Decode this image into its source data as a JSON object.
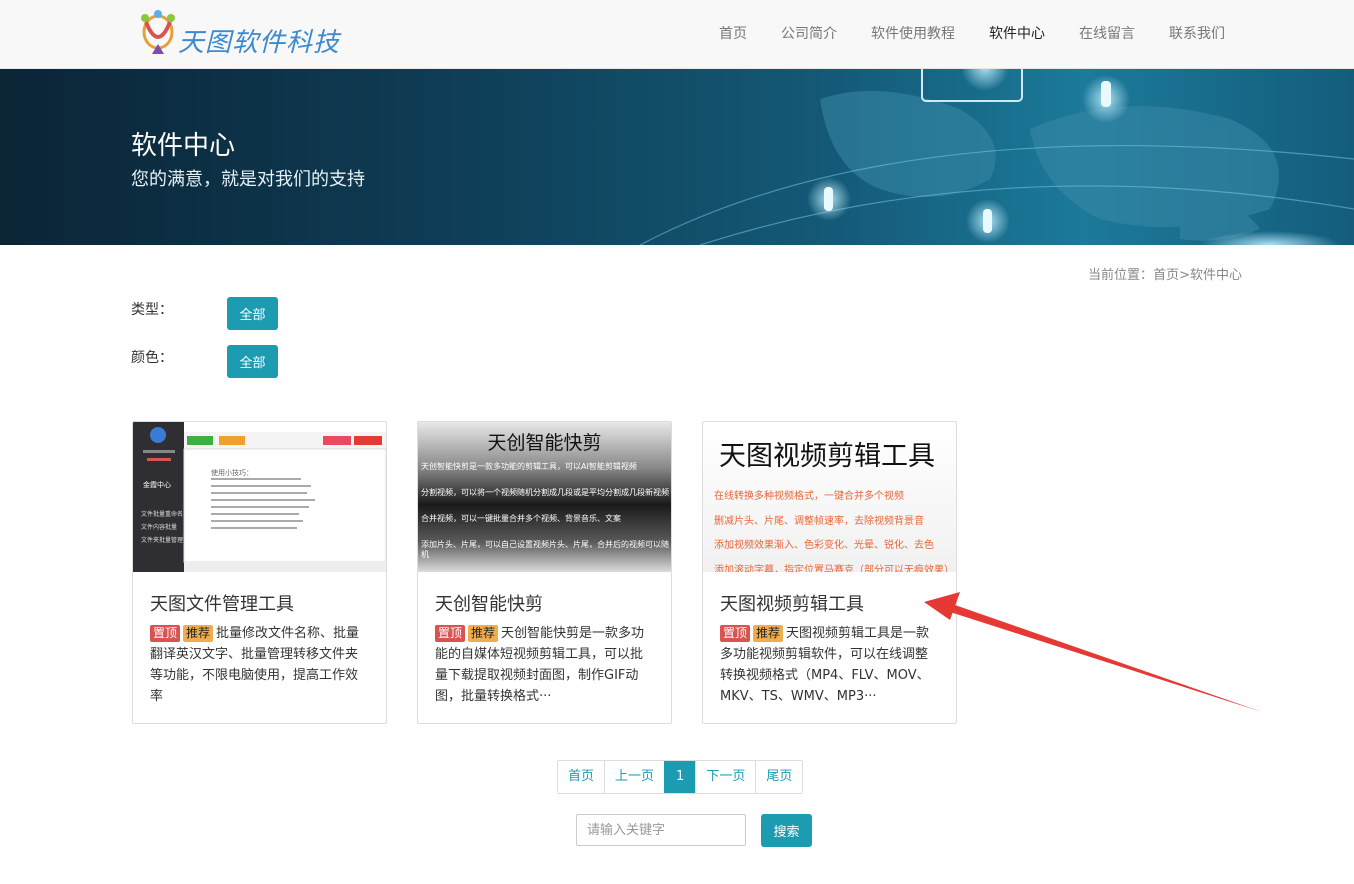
{
  "header": {
    "logo_text": "天图软件科技",
    "nav": [
      {
        "label": "首页"
      },
      {
        "label": "公司简介"
      },
      {
        "label": "软件使用教程"
      },
      {
        "label": "软件中心",
        "active": true
      },
      {
        "label": "在线留言"
      },
      {
        "label": "联系我们"
      }
    ]
  },
  "banner": {
    "title": "软件中心",
    "subtitle": "您的满意，就是对我们的支持"
  },
  "breadcrumb": {
    "prefix": "当前位置：",
    "home": "首页",
    "separator": ">",
    "current": "软件中心"
  },
  "filters": {
    "type_label": "类型：",
    "type_value": "全部",
    "color_label": "颜色：",
    "color_value": "全部"
  },
  "badges": {
    "top": "置顶",
    "recommend": "推荐"
  },
  "cards": [
    {
      "title": "天图文件管理工具",
      "desc": "批量修改文件名称、批量翻译英汉文字、批量管理转移文件夹等功能，不限电脑使用，提高工作效率",
      "thumb": {
        "app_brand": "金霞中心",
        "hint_title": "使用小技巧：",
        "menu": [
          "文件批量重命名",
          "文件内容批量",
          "文件夹批量管理"
        ]
      }
    },
    {
      "title": "天创智能快剪",
      "desc": "天创智能快剪是一款多功能的自媒体短视频剪辑工具，可以批量下载提取视频封面图，制作GIF动图，批量转换格式···",
      "thumb": {
        "heading": "天创智能快剪",
        "lines": [
          "天创智能快剪是一款多功能的剪辑工具，可以AI智能剪辑视频",
          "分割视频，可以将一个视频随机分割成几段或是平均分割成几段新视频",
          "合并视频，可以一键批量合并多个视频、背景音乐、文案",
          "添加片头、片尾，可以自己设置视频片头、片尾，合并后的视频可以随机"
        ]
      }
    },
    {
      "title": "天图视频剪辑工具",
      "desc": "天图视频剪辑工具是一款多功能视频剪辑软件，可以在线调整转换视频格式（MP4、FLV、MOV、MKV、TS、WMV、MP3···",
      "thumb": {
        "heading": "天图视频剪辑工具",
        "lines": [
          "在线转换多种视频格式，一键合并多个视频",
          "删减片头、片尾、调整帧速率，去除视频背景音",
          "添加视频效果渐入、色彩变化、光晕、锐化、去色",
          "添加滚动字幕，指定位置马赛克（部分可以无痕效果）"
        ]
      }
    }
  ],
  "pagination": {
    "first": "首页",
    "prev": "上一页",
    "current": "1",
    "next": "下一页",
    "last": "尾页"
  },
  "search": {
    "placeholder": "请输入关键字",
    "button": "搜索"
  },
  "colors": {
    "accent": "#1d9bb0",
    "badge_top": "#d9534f",
    "badge_recommend": "#f0ad4e",
    "annotation_arrow": "#e53935"
  }
}
